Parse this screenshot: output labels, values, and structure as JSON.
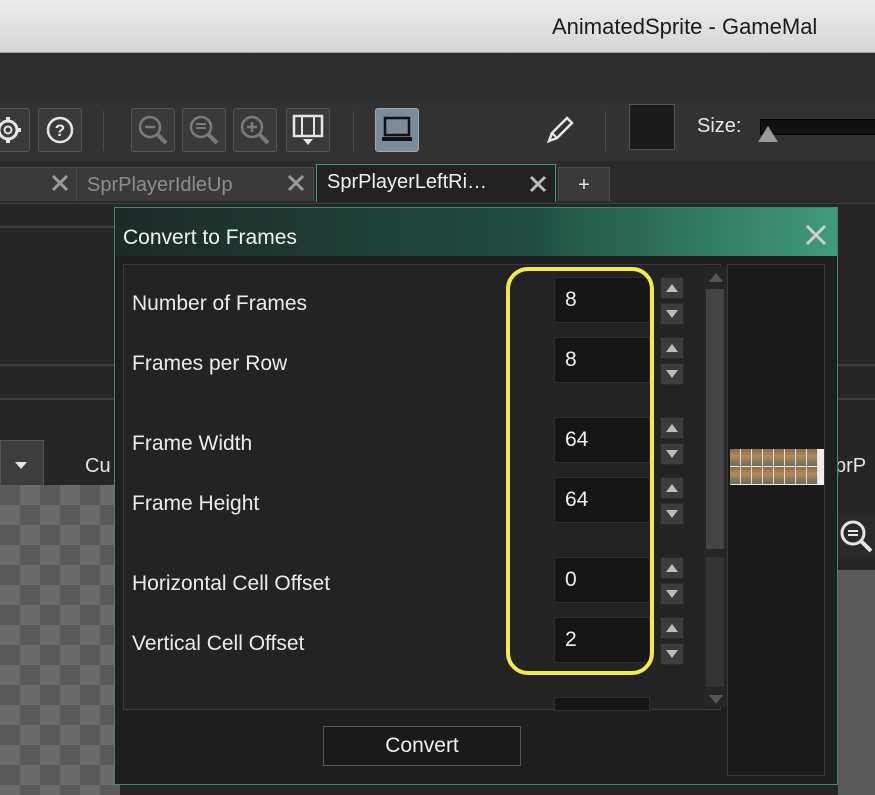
{
  "window": {
    "title": "AnimatedSprite - GameMal"
  },
  "toolbar": {
    "size_label": "Size:",
    "buttons": [
      "gear-icon",
      "help-icon",
      "zoom-out-icon",
      "zoom-reset-icon",
      "zoom-in-icon",
      "fit-icon",
      "preview-icon",
      "pencil-icon"
    ]
  },
  "tabs": [
    {
      "label": "",
      "active": false
    },
    {
      "label": "SprPlayerIdleUp",
      "active": false
    },
    {
      "label": "SprPlayerLeftRi…",
      "active": true
    },
    {
      "label": "+",
      "active": false
    }
  ],
  "background": {
    "cu_text": "Cu",
    "spr_text": "prP"
  },
  "dialog": {
    "title": "Convert to Frames",
    "fields": [
      {
        "label": "Number of Frames",
        "value": "8"
      },
      {
        "label": "Frames per Row",
        "value": "8"
      },
      {
        "label": "Frame Width",
        "value": "64"
      },
      {
        "label": "Frame Height",
        "value": "64"
      },
      {
        "label": "Horizontal Cell Offset",
        "value": "0"
      },
      {
        "label": "Vertical Cell Offset",
        "value": "2"
      }
    ],
    "convert_label": "Convert"
  },
  "colors": {
    "accent": "#3f9c7b",
    "highlight": "#f5ea4a"
  }
}
